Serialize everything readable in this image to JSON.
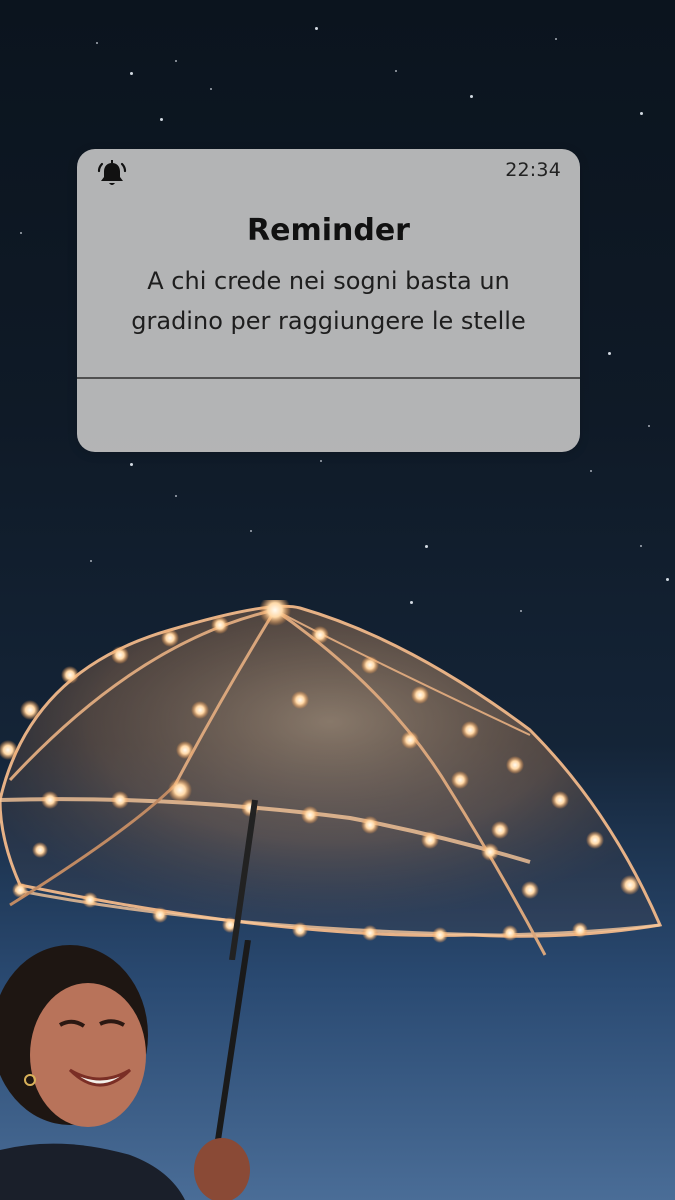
{
  "notification": {
    "icon": "alarm-bell-icon",
    "time": "22:34",
    "title": "Reminder",
    "message": "A chi crede nei sogni basta un gradino per raggiungere le stelle"
  },
  "background": {
    "sky_color": "#0f1a27",
    "horizon_color": "#4a6d97",
    "light_color": "#ffd9a8"
  }
}
